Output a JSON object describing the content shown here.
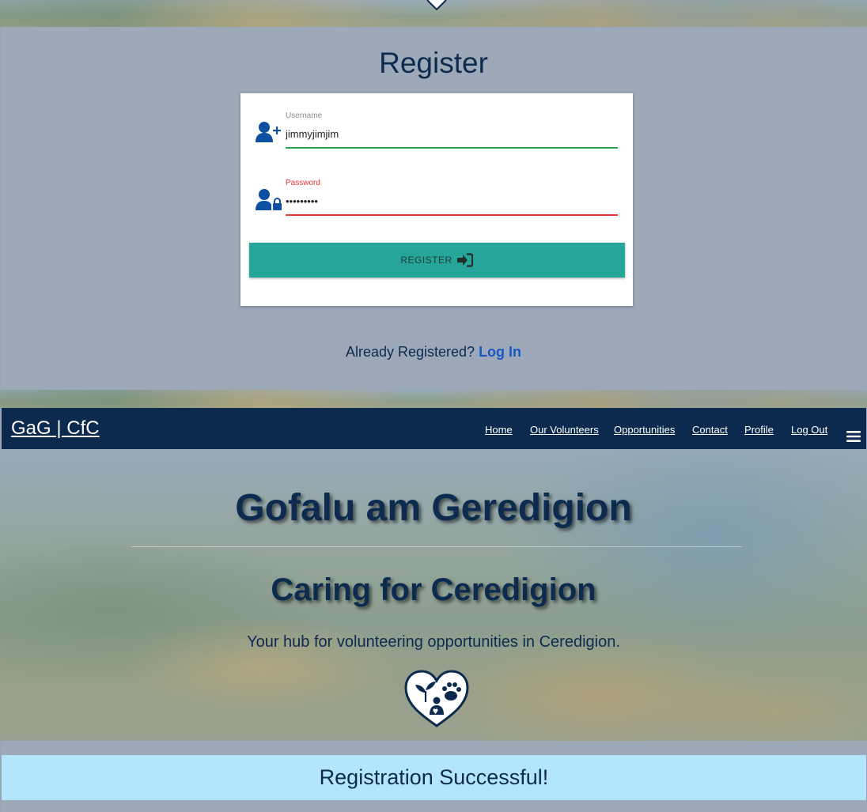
{
  "register": {
    "title": "Register",
    "username": {
      "label": "Username",
      "value": "jimmyjimjim"
    },
    "password": {
      "label": "Password",
      "value": "jimmyjimj"
    },
    "submit_label": "REGISTER",
    "already_text": "Already Registered?",
    "login_link": "Log In"
  },
  "navbar": {
    "brand": "GaG | CfC",
    "links": [
      "Home",
      "Our Volunteers",
      "Opportunities",
      "Contact",
      "Profile",
      "Log Out"
    ]
  },
  "hero": {
    "title": "Gofalu am Geredigion",
    "subtitle": "Caring for Ceredigion",
    "tagline": "Your hub for volunteering opportunities in Ceredigion."
  },
  "alert": {
    "message": "Registration Successful!"
  },
  "colors": {
    "navy": "#0b2a4d",
    "teal_button": "#26a69a",
    "valid_underline": "#2ea44f",
    "invalid_underline": "#e53935",
    "alert_bg": "#b3e5fc",
    "link": "#1a56c4"
  },
  "icons": [
    "chevron-down-icon",
    "user-plus-icon",
    "user-lock-icon",
    "sign-in-icon",
    "hamburger-icon",
    "heart-logo-icon"
  ]
}
